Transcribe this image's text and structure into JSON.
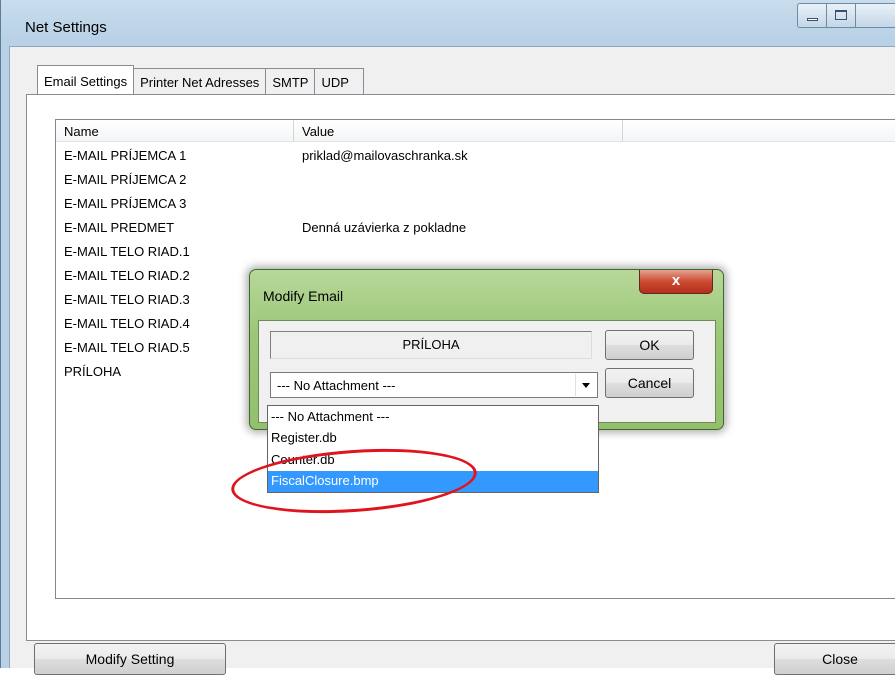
{
  "window": {
    "title": "Net Settings",
    "minimize_icon": "minimize-icon",
    "maximize_icon": "maximize-icon"
  },
  "tabs": [
    {
      "label": "Email Settings",
      "active": true
    },
    {
      "label": "Printer Net Adresses",
      "active": false
    },
    {
      "label": "SMTP",
      "active": false
    },
    {
      "label": "UDP",
      "active": false
    }
  ],
  "list": {
    "columns": [
      "Name",
      "Value"
    ],
    "rows": [
      {
        "name": "E-MAIL PRÍJEMCA 1",
        "value": "priklad@mailovaschranka.sk"
      },
      {
        "name": "E-MAIL PRÍJEMCA 2",
        "value": ""
      },
      {
        "name": "E-MAIL PRÍJEMCA 3",
        "value": ""
      },
      {
        "name": "E-MAIL PREDMET",
        "value": "Denná uzávierka z pokladne"
      },
      {
        "name": "E-MAIL TELO RIAD.1",
        "value": ""
      },
      {
        "name": "E-MAIL TELO RIAD.2",
        "value": ""
      },
      {
        "name": "E-MAIL TELO RIAD.3",
        "value": ""
      },
      {
        "name": "E-MAIL TELO RIAD.4",
        "value": ""
      },
      {
        "name": "E-MAIL TELO RIAD.5",
        "value": ""
      },
      {
        "name": "PRÍLOHA",
        "value": ""
      }
    ]
  },
  "buttons": {
    "modify": "Modify Setting",
    "close": "Close"
  },
  "dialog": {
    "title": "Modify Email",
    "close_glyph": "x",
    "field_label": "PRÍLOHA",
    "ok": "OK",
    "cancel": "Cancel",
    "combo_value": "--- No Attachment ---",
    "options": [
      {
        "label": "--- No Attachment ---",
        "selected": false
      },
      {
        "label": "Register.db",
        "selected": false
      },
      {
        "label": "Counter.db",
        "selected": false
      },
      {
        "label": "FiscalClosure.bmp",
        "selected": true
      }
    ]
  },
  "colors": {
    "selection": "#3399ff",
    "annotation": "#e0141e",
    "dialog_frame": "#9cc777"
  }
}
